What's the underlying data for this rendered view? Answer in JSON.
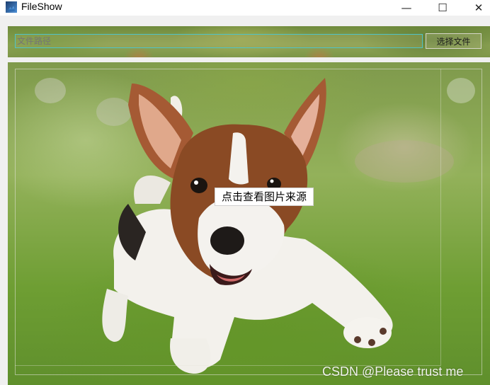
{
  "window": {
    "title": "FileShow",
    "minimize_glyph": "—",
    "maximize_glyph": "☐",
    "close_glyph": "✕"
  },
  "toolbar": {
    "path_placeholder": "文件路径",
    "select_button_label": "选择文件"
  },
  "viewer": {
    "image_subject": "puppy-photo",
    "source_button_label": "点击查看图片来源"
  },
  "watermark": "CSDN @Please trust me"
}
